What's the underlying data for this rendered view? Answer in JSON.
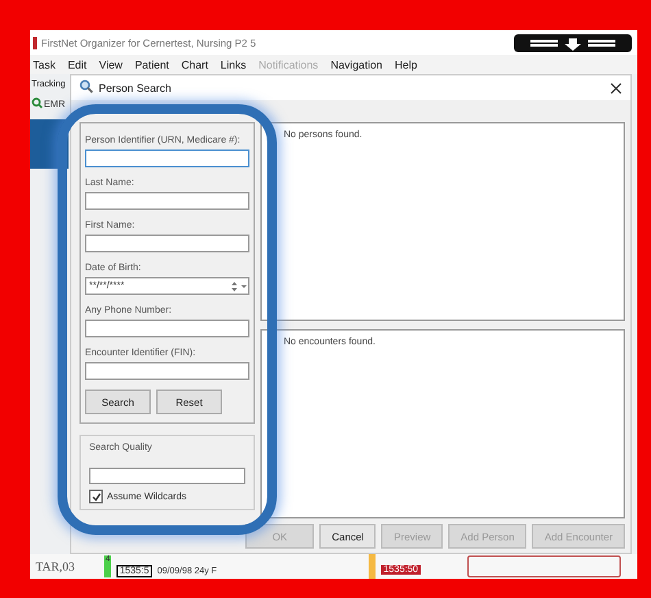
{
  "window": {
    "title": "FirstNet Organizer for Cernertest, Nursing P2 5"
  },
  "menu": [
    {
      "label": "Task",
      "disabled": false
    },
    {
      "label": "Edit",
      "disabled": false
    },
    {
      "label": "View",
      "disabled": false
    },
    {
      "label": "Patient",
      "disabled": false
    },
    {
      "label": "Chart",
      "disabled": false
    },
    {
      "label": "Links",
      "disabled": false
    },
    {
      "label": "Notifications",
      "disabled": true
    },
    {
      "label": "Navigation",
      "disabled": false
    },
    {
      "label": "Help",
      "disabled": false
    }
  ],
  "background": {
    "tab": "Tracking",
    "toolbar_item": "EMR",
    "row": {
      "bed": "TAR,03",
      "acuity": "4",
      "time_box": "1535:5",
      "patient_info": "09/09/98 24y F",
      "alert_time": "1535:50"
    }
  },
  "dialog": {
    "title": "Person Search",
    "fields": [
      {
        "label": "Person Identifier (URN, Medicare #):",
        "kind": "text",
        "focused": true
      },
      {
        "label": "Last Name:",
        "kind": "text",
        "focused": false
      },
      {
        "label": "First Name:",
        "kind": "text",
        "focused": false
      },
      {
        "label": "Date of Birth:",
        "kind": "date",
        "focused": false,
        "value": "**/**/****"
      },
      {
        "label": "Any Phone Number:",
        "kind": "text",
        "focused": false
      },
      {
        "label": "Encounter Identifier (FIN):",
        "kind": "text",
        "focused": false
      }
    ],
    "buttons": [
      {
        "label": "Search"
      },
      {
        "label": "Reset"
      }
    ],
    "search_quality": {
      "title": "Search Quality",
      "assume_wildcards": {
        "label": "Assume Wildcards",
        "checked": true
      }
    },
    "persons_list": {
      "message": "No persons found."
    },
    "encounters_list": {
      "message": "No encounters found."
    },
    "footer_buttons": [
      {
        "label": "OK",
        "disabled": true
      },
      {
        "label": "Cancel",
        "disabled": false
      },
      {
        "label": "Preview",
        "disabled": true
      },
      {
        "label": "Add Person",
        "disabled": true
      },
      {
        "label": "Add Encounter",
        "disabled": true
      }
    ]
  }
}
